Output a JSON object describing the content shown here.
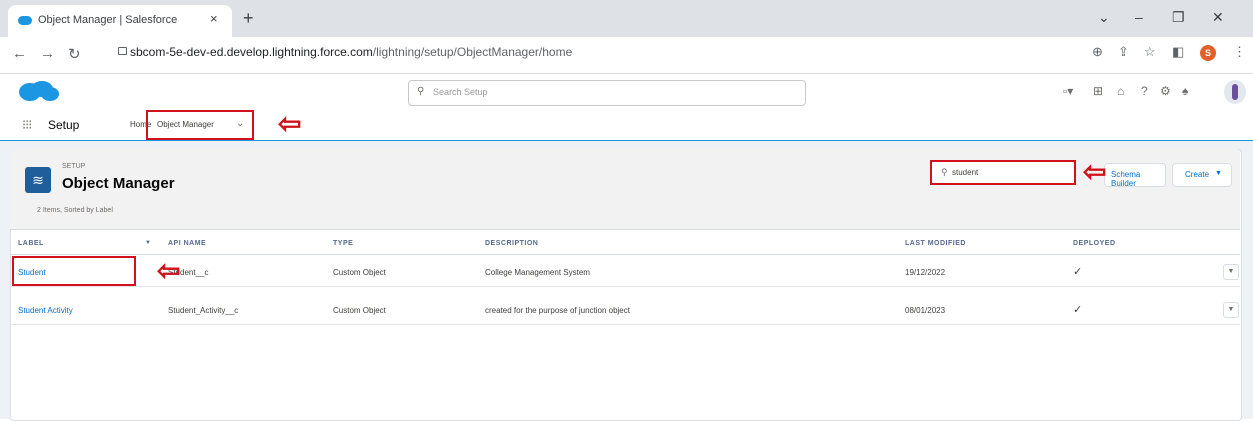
{
  "browser": {
    "tab_title": "Object Manager | Salesforce",
    "tab_close": "×",
    "new_tab": "+",
    "url_domain": "sbcom-5e-dev-ed.develop.lightning.force.com",
    "url_path": "/lightning/setup/ObjectManager/home",
    "profile_initial": "S"
  },
  "header": {
    "search_placeholder": "Search Setup"
  },
  "context_bar": {
    "app_name": "Setup",
    "home_tab": "Home",
    "object_manager_tab": "Object Manager"
  },
  "page": {
    "eyebrow": "SETUP",
    "title": "Object Manager",
    "items_count": "2 Items, Sorted by Label",
    "quick_find_value": "student",
    "schema_builder_label": "Schema Builder",
    "create_label": "Create"
  },
  "table": {
    "columns": [
      "LABEL",
      "API NAME",
      "TYPE",
      "DESCRIPTION",
      "LAST MODIFIED",
      "DEPLOYED"
    ],
    "sort_indicator": "▼",
    "rows": [
      {
        "label": "Student",
        "api_name": "Student__c",
        "type": "Custom Object",
        "description": "College Management System",
        "last_modified": "19/12/2022",
        "deployed": "✓"
      },
      {
        "label": "Student Activity",
        "api_name": "Student_Activity__c",
        "type": "Custom Object",
        "description": "created for the purpose of junction object",
        "last_modified": "08/01/2023",
        "deployed": "✓"
      }
    ]
  },
  "colors": {
    "annotation_red": "#d0121b",
    "brand_blue": "#1b96e0",
    "link_blue": "#0070d2"
  }
}
